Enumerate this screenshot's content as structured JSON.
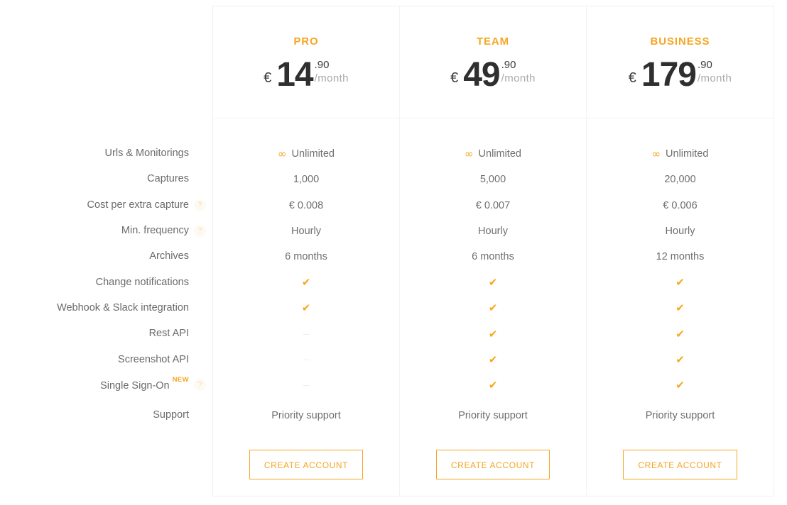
{
  "theme": {
    "accent": "#f5a623",
    "text": "#6b6b6b",
    "price_text": "#2f2f2f",
    "muted": "#a9a9a9",
    "border": "#f0f0f0"
  },
  "features": [
    {
      "label": "Urls & Monitorings",
      "help": false,
      "new": false
    },
    {
      "label": "Captures",
      "help": false,
      "new": false
    },
    {
      "label": "Cost per extra capture",
      "help": true,
      "help_label": "?",
      "new": false
    },
    {
      "label": "Min. frequency",
      "help": true,
      "help_label": "?",
      "new": false
    },
    {
      "label": "Archives",
      "help": false,
      "new": false
    },
    {
      "label": "Change notifications",
      "help": false,
      "new": false
    },
    {
      "label": "Webhook & Slack integration",
      "help": false,
      "new": false
    },
    {
      "label": "Rest API",
      "help": false,
      "new": false
    },
    {
      "label": "Screenshot API",
      "help": false,
      "new": false
    },
    {
      "label": "Single Sign-On",
      "help": true,
      "help_label": "?",
      "new": true,
      "new_label": "NEW"
    },
    {
      "label": "Support",
      "help": false,
      "new": false
    }
  ],
  "plans": [
    {
      "name": "PRO",
      "currency": "€",
      "amount": "14",
      "cents": ".90",
      "period": "/month",
      "values": [
        {
          "type": "infinity",
          "icon": "∞",
          "text": "Unlimited"
        },
        {
          "type": "text",
          "text": "1,000"
        },
        {
          "type": "text",
          "text": "€ 0.008"
        },
        {
          "type": "text",
          "text": "Hourly"
        },
        {
          "type": "text",
          "text": "6 months"
        },
        {
          "type": "check",
          "icon": "✔"
        },
        {
          "type": "check",
          "icon": "✔"
        },
        {
          "type": "dash"
        },
        {
          "type": "dash"
        },
        {
          "type": "dash"
        },
        {
          "type": "text",
          "text": "Priority support"
        }
      ],
      "cta": "CREATE ACCOUNT"
    },
    {
      "name": "TEAM",
      "currency": "€",
      "amount": "49",
      "cents": ".90",
      "period": "/month",
      "values": [
        {
          "type": "infinity",
          "icon": "∞",
          "text": "Unlimited"
        },
        {
          "type": "text",
          "text": "5,000"
        },
        {
          "type": "text",
          "text": "€ 0.007"
        },
        {
          "type": "text",
          "text": "Hourly"
        },
        {
          "type": "text",
          "text": "6 months"
        },
        {
          "type": "check",
          "icon": "✔"
        },
        {
          "type": "check",
          "icon": "✔"
        },
        {
          "type": "check",
          "icon": "✔"
        },
        {
          "type": "check",
          "icon": "✔"
        },
        {
          "type": "check",
          "icon": "✔"
        },
        {
          "type": "text",
          "text": "Priority support"
        }
      ],
      "cta": "CREATE ACCOUNT"
    },
    {
      "name": "BUSINESS",
      "currency": "€",
      "amount": "179",
      "cents": ".90",
      "period": "/month",
      "values": [
        {
          "type": "infinity",
          "icon": "∞",
          "text": "Unlimited"
        },
        {
          "type": "text",
          "text": "20,000"
        },
        {
          "type": "text",
          "text": "€ 0.006"
        },
        {
          "type": "text",
          "text": "Hourly"
        },
        {
          "type": "text",
          "text": "12 months"
        },
        {
          "type": "check",
          "icon": "✔"
        },
        {
          "type": "check",
          "icon": "✔"
        },
        {
          "type": "check",
          "icon": "✔"
        },
        {
          "type": "check",
          "icon": "✔"
        },
        {
          "type": "check",
          "icon": "✔"
        },
        {
          "type": "text",
          "text": "Priority support"
        }
      ],
      "cta": "CREATE ACCOUNT"
    }
  ]
}
